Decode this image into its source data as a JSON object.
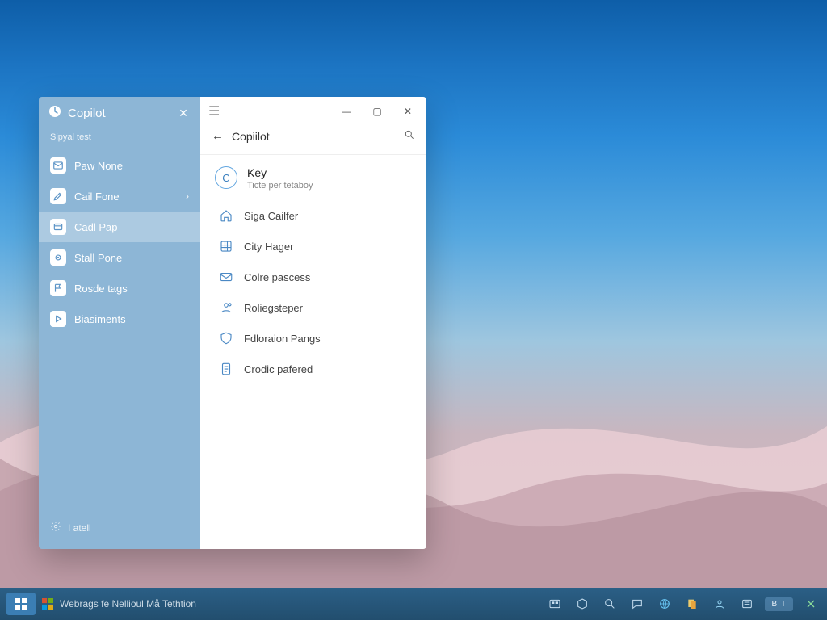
{
  "colors": {
    "accent": "#4a88c4",
    "sidebar": "#8db6d6",
    "taskbar": "#2b5f86"
  },
  "sidebar": {
    "title": "Copilot",
    "subtitle": "Sipyal test",
    "items": [
      {
        "label": "Paw None",
        "icon": "mail"
      },
      {
        "label": "Cail Fone",
        "icon": "edit",
        "chevron": true
      },
      {
        "label": "Cadl Pap",
        "icon": "card",
        "selected": true
      },
      {
        "label": "Stall Pone",
        "icon": "dot"
      },
      {
        "label": "Rosde tags",
        "icon": "flag"
      },
      {
        "label": "Biasiments",
        "icon": "play"
      }
    ],
    "footer": "I atell"
  },
  "main": {
    "search_label": "Copiilot",
    "hero": {
      "badge": "C",
      "title": "Key",
      "subtitle": "Ticte per tetaboy"
    },
    "items": [
      {
        "label": "Siga Cailfer",
        "icon": "house"
      },
      {
        "label": "City Hager",
        "icon": "grid"
      },
      {
        "label": "Colre pascess",
        "icon": "envelope"
      },
      {
        "label": "Roliegsteper",
        "icon": "person"
      },
      {
        "label": "Fdloraion Pangs",
        "icon": "shield"
      },
      {
        "label": "Crodic pafered",
        "icon": "doc"
      }
    ]
  },
  "taskbar": {
    "label": "Webrags fe  Nellioul Må Tethtion",
    "pill": "B:T"
  }
}
